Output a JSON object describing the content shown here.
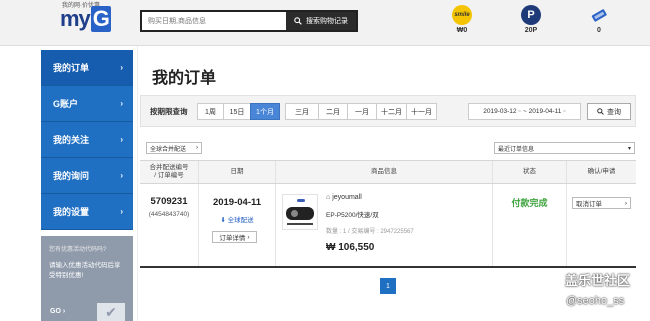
{
  "header": {
    "logo_sub": "我的网·价优惠",
    "logo_text": "my",
    "logo_g": "G",
    "search_placeholder": "购买日期,商品信息",
    "search_button": "搜索购物记录",
    "stats": [
      {
        "icon": "smile-icon",
        "label": "smile",
        "value": "₩0"
      },
      {
        "icon": "p-coin-icon",
        "label": "P",
        "value": "20P"
      },
      {
        "icon": "coupon-icon",
        "label": "",
        "value": "0"
      }
    ]
  },
  "sidebar": {
    "items": [
      {
        "label": "我的订单"
      },
      {
        "label": "G账户"
      },
      {
        "label": "我的关注"
      },
      {
        "label": "我的询问"
      },
      {
        "label": "我的设置"
      }
    ],
    "promo": {
      "title": "您有优惠活动代码吗?",
      "text": "请输入优惠活动代码后享受特别优惠!",
      "go": "GO",
      "arrow": "›"
    }
  },
  "main": {
    "title": "我的订单",
    "period": {
      "label": "按期限查询",
      "buttons": [
        "1周",
        "15日",
        "1个月",
        "三月",
        "二月",
        "一月",
        "十二月",
        "十一月"
      ],
      "active_index": 2,
      "date_from": "2019-03-12",
      "date_to": "2019-04-11",
      "query_label": "查询"
    },
    "filter_left": "全球合并配送",
    "filter_right": "最近订单信息",
    "table": {
      "headers": [
        "合并配送编号\n/ 订单编号",
        "日期",
        "商品信息",
        "状态",
        "确认/申请"
      ],
      "rows": [
        {
          "order_no": "5709231",
          "order_sub": "(4454843740)",
          "date": "2019-04-11",
          "ship_link": "全球配送",
          "detail_btn": "订单详情",
          "seller": "jeyoumall",
          "product": "EP-P5200/快速/双",
          "qty": "数量 : 1 / 交易编号 : 2947225567",
          "price": "₩ 106,550",
          "status": "付款完成",
          "action": "取消订单"
        }
      ]
    },
    "page": "1"
  },
  "watermark": {
    "line1": "盖乐世社区",
    "line2": "@seoho_ss"
  },
  "colors": {
    "sidebar_blue": "#1f6fc2",
    "status_green": "#3ea33e",
    "active_period": "#4a86d8"
  }
}
